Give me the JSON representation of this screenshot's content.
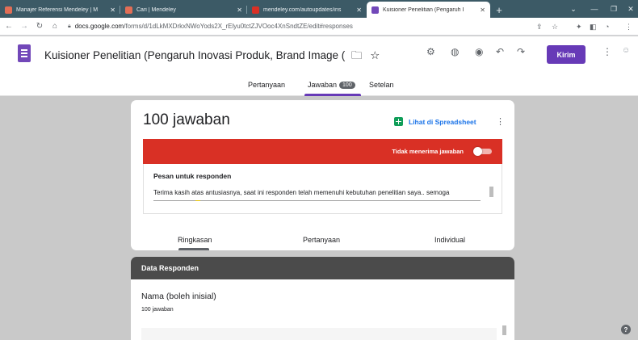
{
  "browser": {
    "tabs": [
      {
        "title": "Manajer Referensi Mendeley | M",
        "favicon_color": "#e26e56"
      },
      {
        "title": "Cari | Mendeley",
        "favicon_color": "#e26e56"
      },
      {
        "title": "mendeley.com/autoupdates/ins",
        "favicon_color": "#d93025"
      },
      {
        "title": "Kuisioner Penelitian (Pengaruh I",
        "favicon_color": "#7248b9",
        "active": true
      }
    ],
    "url_host": "docs.google.com",
    "url_path": "/forms/d/1dLkMXDrkxNWoYods2X_rElyu0tctZJVOoc4XnSndtZE/edit#responses",
    "icons": [
      "back-icon",
      "forward-icon",
      "reload-icon",
      "home-icon",
      "lock-icon",
      "share-icon",
      "star-icon",
      "extensions-icon",
      "sidepanel-icon",
      "profile-icon",
      "menu-icon"
    ]
  },
  "forms_header": {
    "title": "Kuisioner Penelitian (Pengaruh Inovasi Produk, Brand Image (",
    "send_label": "Kirim",
    "tabs": {
      "questions": "Pertanyaan",
      "responses": "Jawaban",
      "responses_badge": "100",
      "settings": "Setelan"
    }
  },
  "summary_card": {
    "count_text": "100 jawaban",
    "spreadsheet_label": "Lihat di Spreadsheet",
    "not_accepting_label": "Tidak menerima jawaban",
    "message_label": "Pesan untuk responden",
    "message_text": "Terima kasih atas antusiasnya, saat ini responden telah memenuhi kebutuhan penelitian saya.. semoga",
    "subtabs": {
      "summary": "Ringkasan",
      "question": "Pertanyaan",
      "individual": "Individual"
    }
  },
  "section_card": {
    "header": "Data Responden",
    "question_title": "Nama (boleh inisial)",
    "question_count": "100 jawaban"
  },
  "colors": {
    "accent": "#673ab7",
    "alert": "#d93025",
    "link": "#1a73e8",
    "sheets_green": "#0f9d58"
  }
}
